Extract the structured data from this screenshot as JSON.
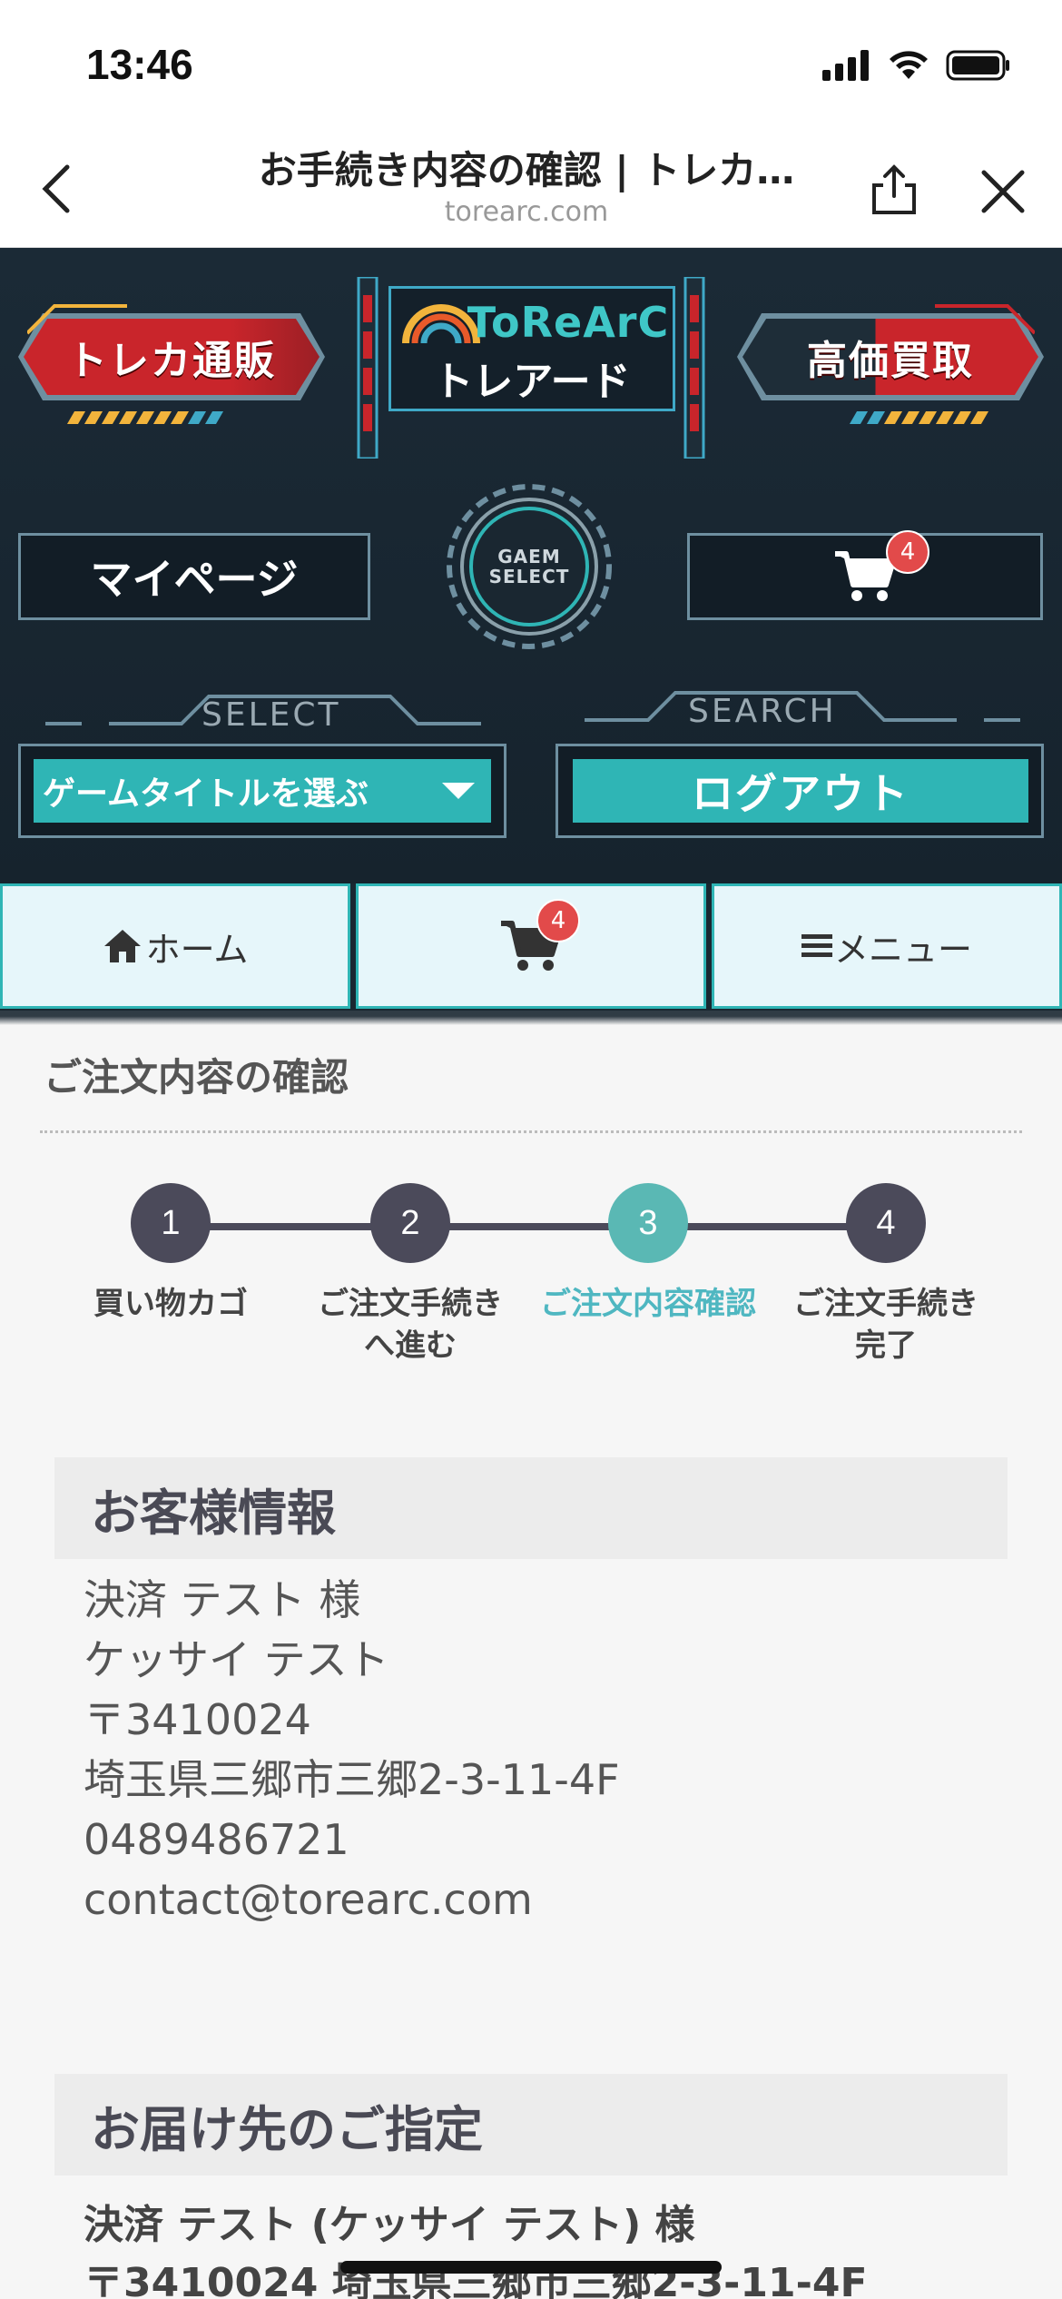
{
  "status_bar": {
    "time": "13:46"
  },
  "browser": {
    "title": "お手続き内容の確認 | トレカ…",
    "url": "torearc.com"
  },
  "header": {
    "buy_label": "トレカ通販",
    "sell_label": "高価買取",
    "logo_name": "ToReArC",
    "logo_kana": "トレアード",
    "mypage_label": "マイページ",
    "gear_line1": "GAEM",
    "gear_line2": "SELECT",
    "cart_count": "4",
    "select_caption": "SELECT",
    "search_caption": "SEARCH",
    "select_value": "ゲームタイトルを選ぶ",
    "logout_label": "ログアウト"
  },
  "tabs": {
    "home_label": "ホーム",
    "cart_count": "4",
    "menu_label": "メニュー"
  },
  "page": {
    "title": "ご注文内容の確認",
    "steps": [
      {
        "num": "1",
        "label": "買い物カゴ"
      },
      {
        "num": "2",
        "label": "ご注文手続きへ進む"
      },
      {
        "num": "3",
        "label": "ご注文内容確認"
      },
      {
        "num": "4",
        "label": "ご注文手続き完了"
      }
    ],
    "customer": {
      "heading": "お客様情報",
      "name": "決済 テスト 様",
      "kana": "ケッサイ テスト",
      "postal": "〒3410024",
      "address": "埼玉県三郷市三郷2-3-11-4F",
      "phone": "0489486721",
      "email": "contact@torearc.com"
    },
    "shipping": {
      "heading": "お届け先のご指定",
      "name": "決済 テスト (ケッサイ テスト) 様",
      "address": "〒3410024 埼玉県三郷市三郷2-3-11-4F"
    }
  },
  "colors": {
    "teal": "#2fb5b5",
    "step_active": "#5ab8b4",
    "step_default": "#4b4a5a",
    "header_bg": "#1b2a36",
    "badge": "#e24a4a"
  }
}
